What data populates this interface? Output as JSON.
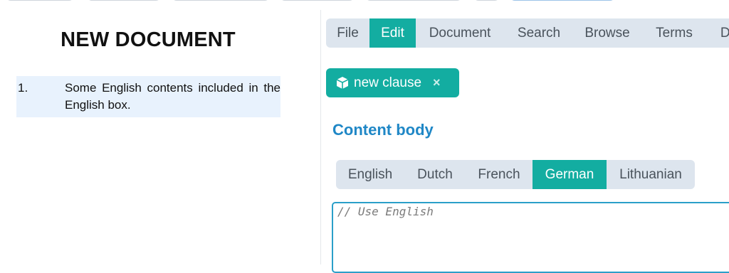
{
  "document": {
    "title": "NEW DOCUMENT",
    "clauses": [
      {
        "number": "1.",
        "text": "Some English contents included in the English box."
      }
    ]
  },
  "menu": {
    "active": "Edit",
    "items": [
      "File",
      "Edit",
      "Document",
      "Search",
      "Browse",
      "Terms",
      "Da"
    ]
  },
  "tag": {
    "icon": "cube-icon",
    "label": "new clause",
    "remove": "×"
  },
  "content": {
    "heading": "Content body",
    "active_language": "German",
    "languages": [
      "English",
      "Dutch",
      "French",
      "German",
      "Lithuanian"
    ],
    "editor_placeholder": "// Use English"
  },
  "colors": {
    "accent": "#13ada1",
    "heading": "#1f87c6",
    "bar_background": "#dde5ee",
    "clause_highlight": "#e8f2fd",
    "editor_border": "#2a9fc9"
  }
}
